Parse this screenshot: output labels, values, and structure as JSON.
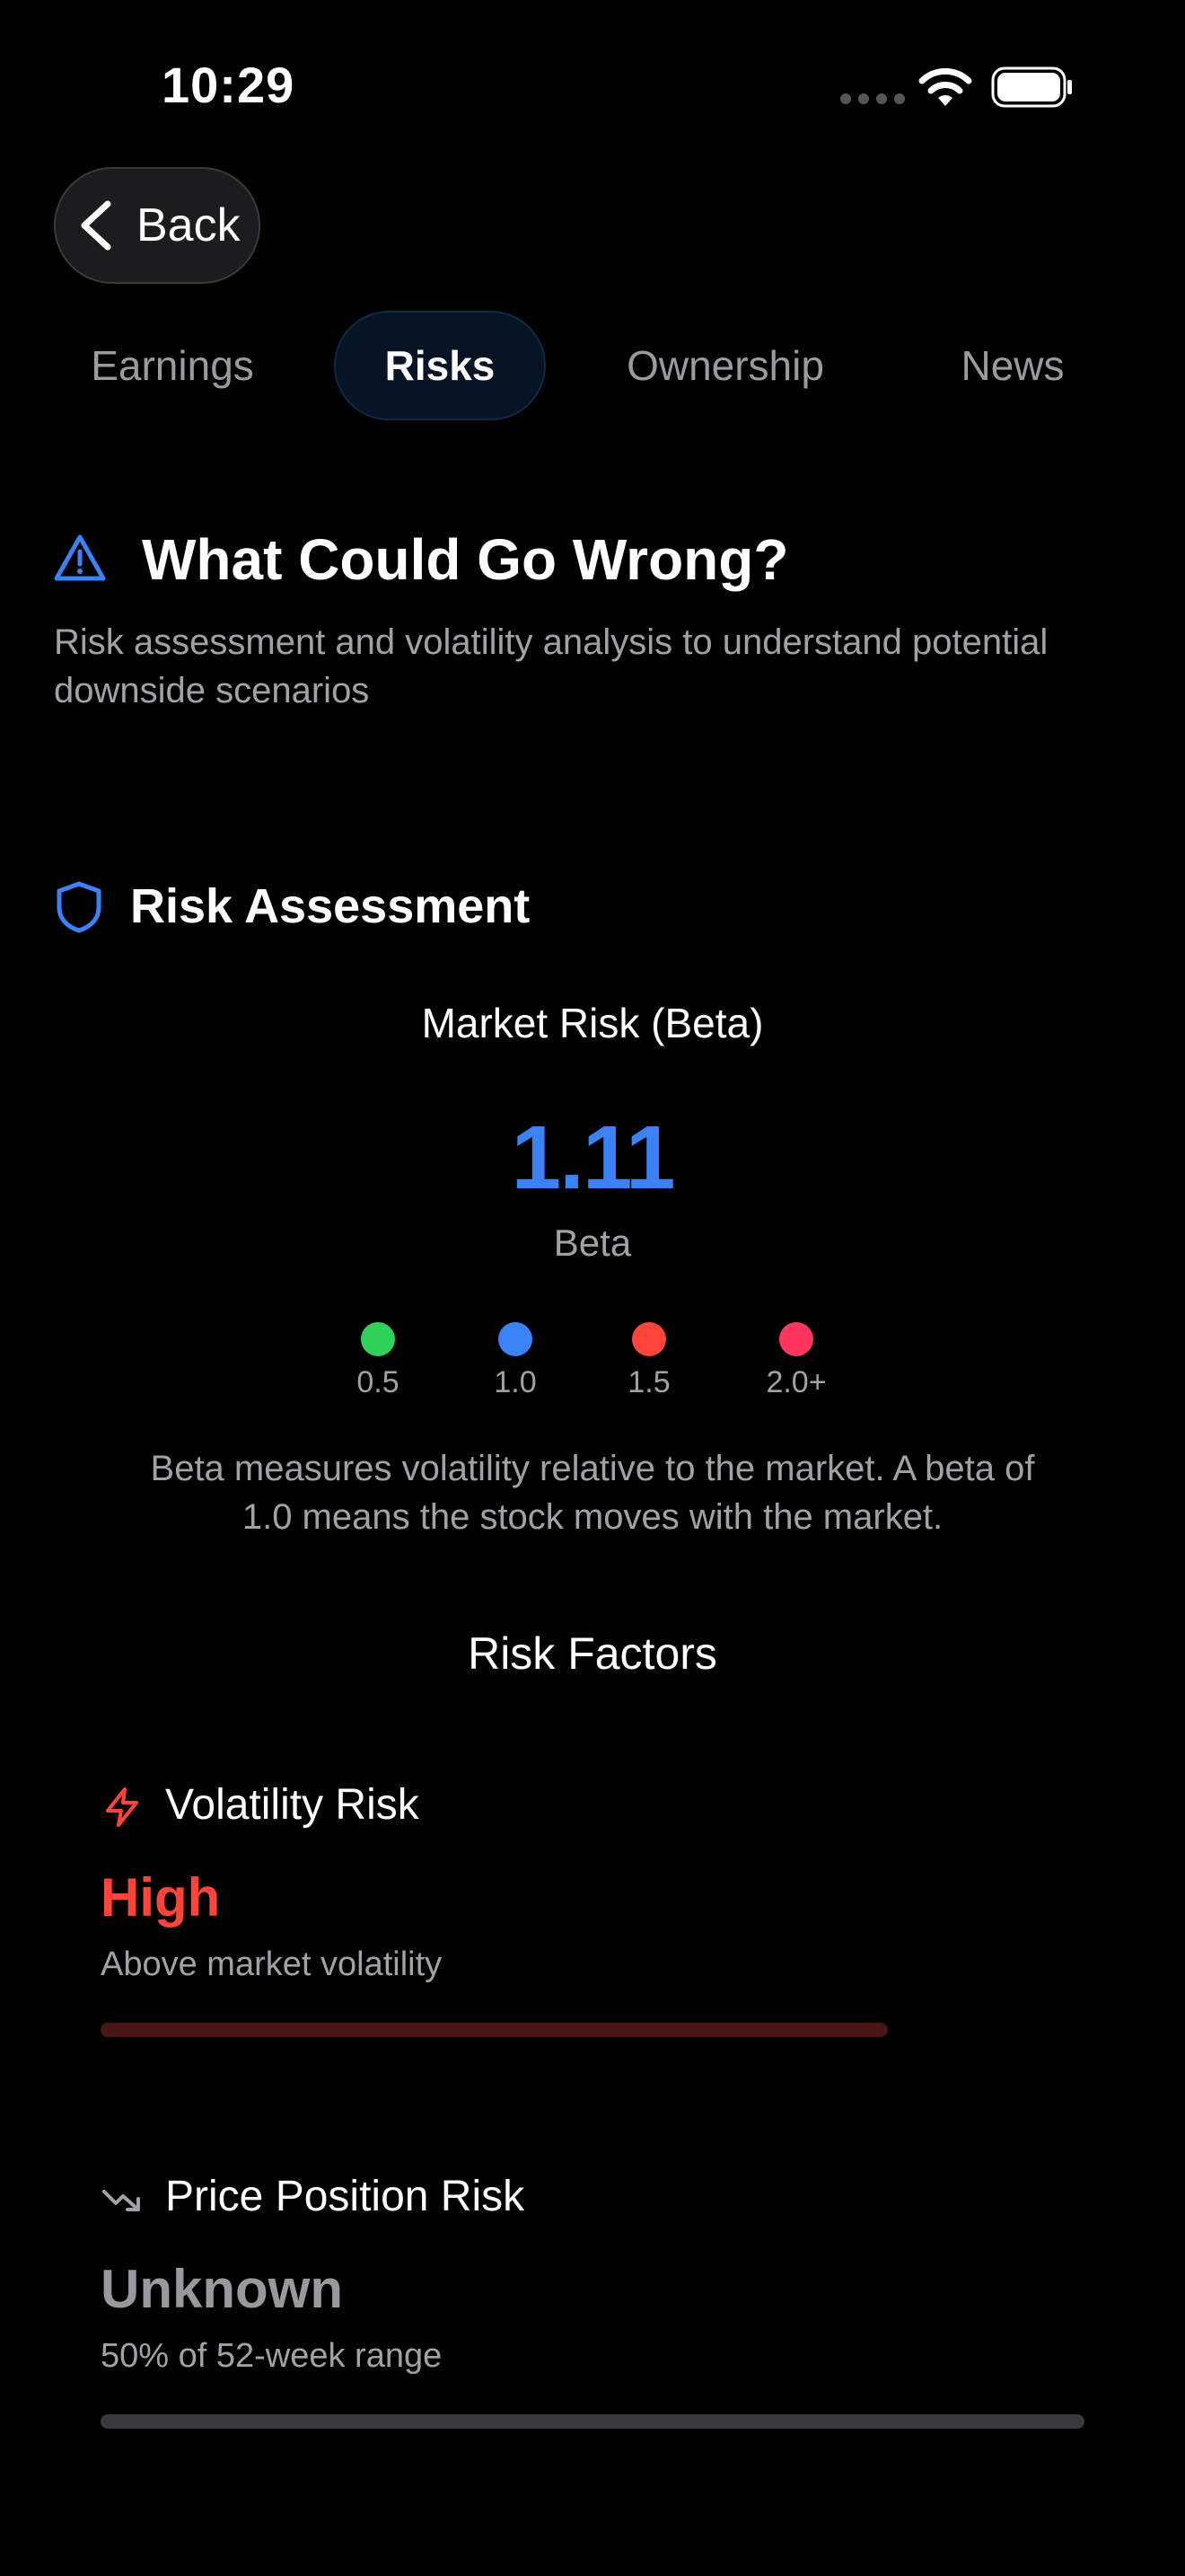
{
  "status_bar": {
    "time": "10:29"
  },
  "nav": {
    "back_label": "Back"
  },
  "tabs": [
    {
      "label": "Earnings",
      "active": false
    },
    {
      "label": "Risks",
      "active": true
    },
    {
      "label": "Ownership",
      "active": false
    },
    {
      "label": "News",
      "active": false
    }
  ],
  "header": {
    "title": "What Could Go Wrong?",
    "subtitle": "Risk assessment and volatility analysis to understand potential downside scenarios"
  },
  "risk_assessment": {
    "title": "Risk Assessment",
    "market_risk_title": "Market Risk (Beta)",
    "beta_value": "1.11",
    "beta_label": "Beta",
    "scale": [
      {
        "label": "0.5",
        "color": "#30d158"
      },
      {
        "label": "1.0",
        "color": "#3b82f6"
      },
      {
        "label": "1.5",
        "color": "#ff453a"
      },
      {
        "label": "2.0+",
        "color": "#ff375f"
      }
    ],
    "note": "Beta measures volatility relative to the market. A beta of 1.0 means the stock moves with the market."
  },
  "risk_factors": {
    "title": "Risk Factors",
    "items": [
      {
        "name": "Volatility Risk",
        "icon": "lightning-icon",
        "level": "High",
        "level_color": "#ff453a",
        "description": "Above market volatility",
        "bar_fraction": 0.8,
        "bar_color": "#4a1515"
      },
      {
        "name": "Price Position Risk",
        "icon": "trending-down-icon",
        "level": "Unknown",
        "level_color": "#98989d",
        "description": "50% of 52-week range",
        "bar_fraction": 1.0,
        "bar_color": "#3a3a3c"
      }
    ]
  },
  "colors": {
    "accent": "#3b82f6",
    "background": "#000000"
  }
}
